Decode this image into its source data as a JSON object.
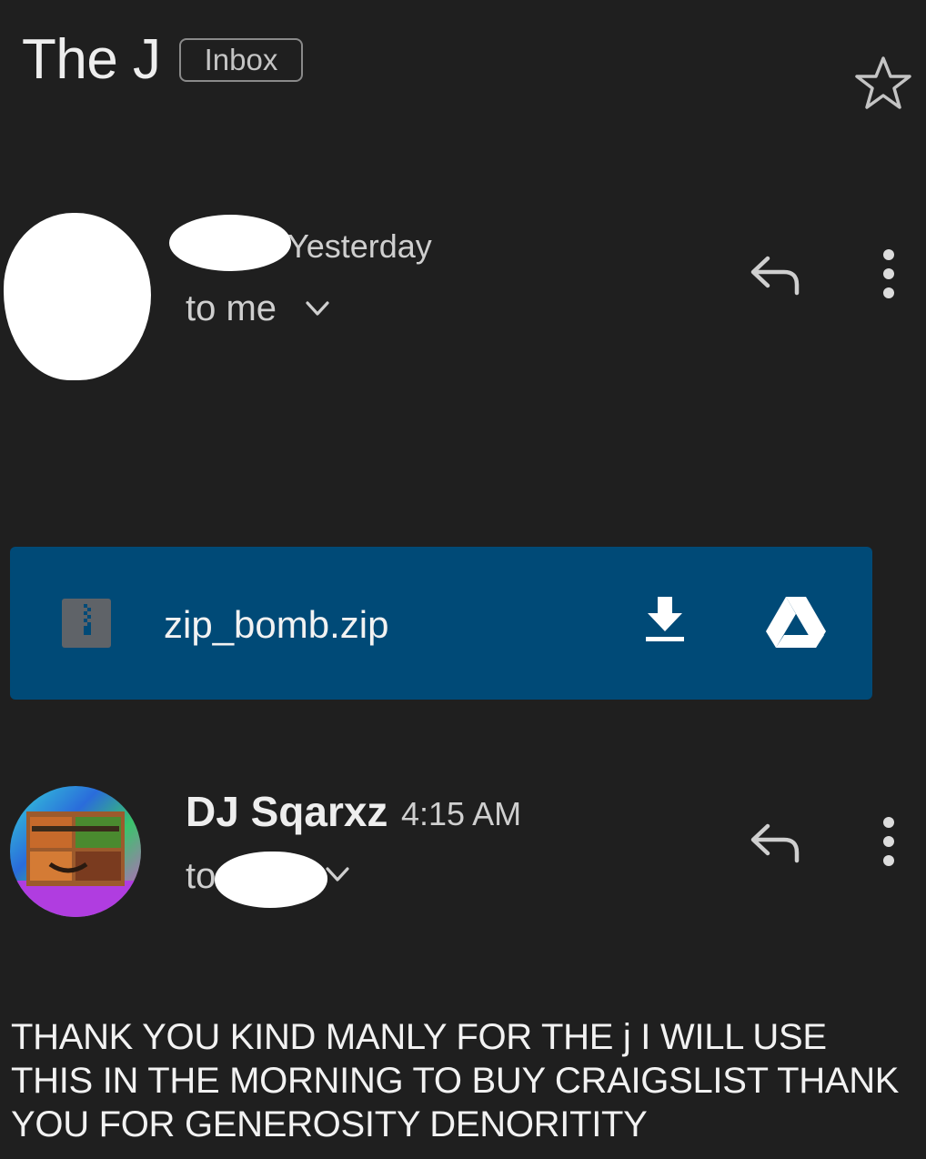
{
  "header": {
    "subject": "The J",
    "label": "Inbox",
    "star_icon": "star-outline-icon"
  },
  "message1": {
    "time": "Yesterday",
    "to": "to me",
    "icons": [
      "reply-icon",
      "more-vert-icon",
      "chevron-down-icon"
    ]
  },
  "attachment": {
    "filename": "zip_bomb.zip",
    "icons": [
      "zip-file-icon",
      "download-icon",
      "drive-icon"
    ],
    "color": "#004a77"
  },
  "message2": {
    "sender": "DJ Sqarxz",
    "time": "4:15 AM",
    "to_prefix": "to",
    "body": "THANK YOU KIND MANLY FOR THE j I WILL USE THIS IN THE MORNING TO BUY CRAIGSLIST THANK YOU FOR GENEROSITY DENORITITY"
  },
  "colors": {
    "background": "#1f1f1f",
    "text": "#e3e3e3",
    "attachment_bar": "#004a77"
  }
}
